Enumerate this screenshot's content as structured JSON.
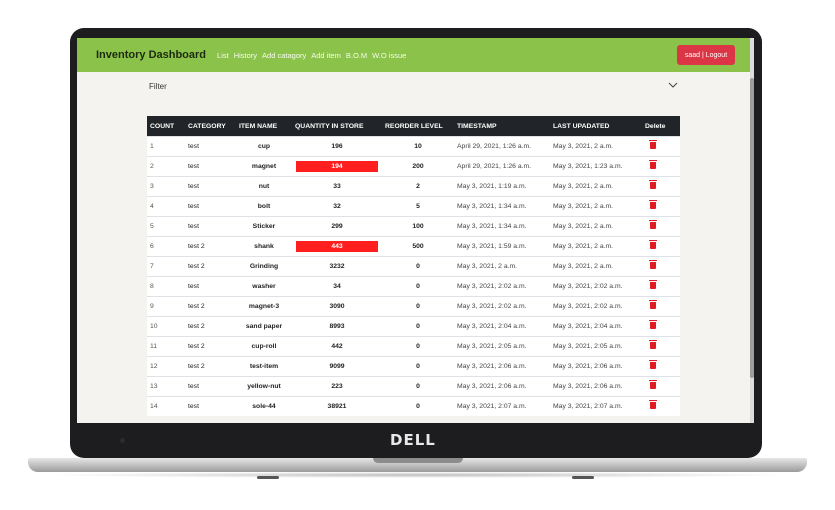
{
  "brand_logo": "DELL",
  "navbar": {
    "title": "Inventory Dashboard",
    "links": [
      "List",
      "History",
      "Add catagory",
      "Add item",
      "B.O.M",
      "W.O issue"
    ],
    "logout_label": "saad | Logout"
  },
  "filter": {
    "label": "Filter",
    "chevron": "chevron-down-icon"
  },
  "colors": {
    "navbar": "#8bc34a",
    "header": "#212529",
    "alert": "#ff1f1f",
    "logout": "#dc3545"
  },
  "table": {
    "headers": [
      "COUNT",
      "CATEGORY",
      "ITEM NAME",
      "QUANTITY IN STORE",
      "REORDER LEVEL",
      "TIMESTAMP",
      "LAST UPADATED",
      "Delete"
    ],
    "rows": [
      {
        "count": "1",
        "category": "test",
        "name": "cup",
        "qty": "196",
        "reorder": "10",
        "timestamp": "April 29, 2021, 1:26 a.m.",
        "updated": "May 3, 2021, 2 a.m.",
        "low": false
      },
      {
        "count": "2",
        "category": "test",
        "name": "magnet",
        "qty": "194",
        "reorder": "200",
        "timestamp": "April 29, 2021, 1:26 a.m.",
        "updated": "May 3, 2021, 1:23 a.m.",
        "low": true
      },
      {
        "count": "3",
        "category": "test",
        "name": "nut",
        "qty": "33",
        "reorder": "2",
        "timestamp": "May 3, 2021, 1:19 a.m.",
        "updated": "May 3, 2021, 2 a.m.",
        "low": false
      },
      {
        "count": "4",
        "category": "test",
        "name": "bolt",
        "qty": "32",
        "reorder": "5",
        "timestamp": "May 3, 2021, 1:34 a.m.",
        "updated": "May 3, 2021, 2 a.m.",
        "low": false
      },
      {
        "count": "5",
        "category": "test",
        "name": "Sticker",
        "qty": "299",
        "reorder": "100",
        "timestamp": "May 3, 2021, 1:34 a.m.",
        "updated": "May 3, 2021, 2 a.m.",
        "low": false
      },
      {
        "count": "6",
        "category": "test 2",
        "name": "shank",
        "qty": "443",
        "reorder": "500",
        "timestamp": "May 3, 2021, 1:59 a.m.",
        "updated": "May 3, 2021, 2 a.m.",
        "low": true
      },
      {
        "count": "7",
        "category": "test 2",
        "name": "Grinding",
        "qty": "3232",
        "reorder": "0",
        "timestamp": "May 3, 2021, 2 a.m.",
        "updated": "May 3, 2021, 2 a.m.",
        "low": false
      },
      {
        "count": "8",
        "category": "test",
        "name": "washer",
        "qty": "34",
        "reorder": "0",
        "timestamp": "May 3, 2021, 2:02 a.m.",
        "updated": "May 3, 2021, 2:02 a.m.",
        "low": false
      },
      {
        "count": "9",
        "category": "test 2",
        "name": "magnet-3",
        "qty": "3090",
        "reorder": "0",
        "timestamp": "May 3, 2021, 2:02 a.m.",
        "updated": "May 3, 2021, 2:02 a.m.",
        "low": false
      },
      {
        "count": "10",
        "category": "test 2",
        "name": "sand paper",
        "qty": "8993",
        "reorder": "0",
        "timestamp": "May 3, 2021, 2:04 a.m.",
        "updated": "May 3, 2021, 2:04 a.m.",
        "low": false
      },
      {
        "count": "11",
        "category": "test 2",
        "name": "cup-roll",
        "qty": "442",
        "reorder": "0",
        "timestamp": "May 3, 2021, 2:05 a.m.",
        "updated": "May 3, 2021, 2:05 a.m.",
        "low": false
      },
      {
        "count": "12",
        "category": "test 2",
        "name": "test-item",
        "qty": "9099",
        "reorder": "0",
        "timestamp": "May 3, 2021, 2:06 a.m.",
        "updated": "May 3, 2021, 2:06 a.m.",
        "low": false
      },
      {
        "count": "13",
        "category": "test",
        "name": "yellow-nut",
        "qty": "223",
        "reorder": "0",
        "timestamp": "May 3, 2021, 2:06 a.m.",
        "updated": "May 3, 2021, 2:06 a.m.",
        "low": false
      },
      {
        "count": "14",
        "category": "test",
        "name": "sole-44",
        "qty": "38921",
        "reorder": "0",
        "timestamp": "May 3, 2021, 2:07 a.m.",
        "updated": "May 3, 2021, 2:07 a.m.",
        "low": false
      }
    ]
  }
}
